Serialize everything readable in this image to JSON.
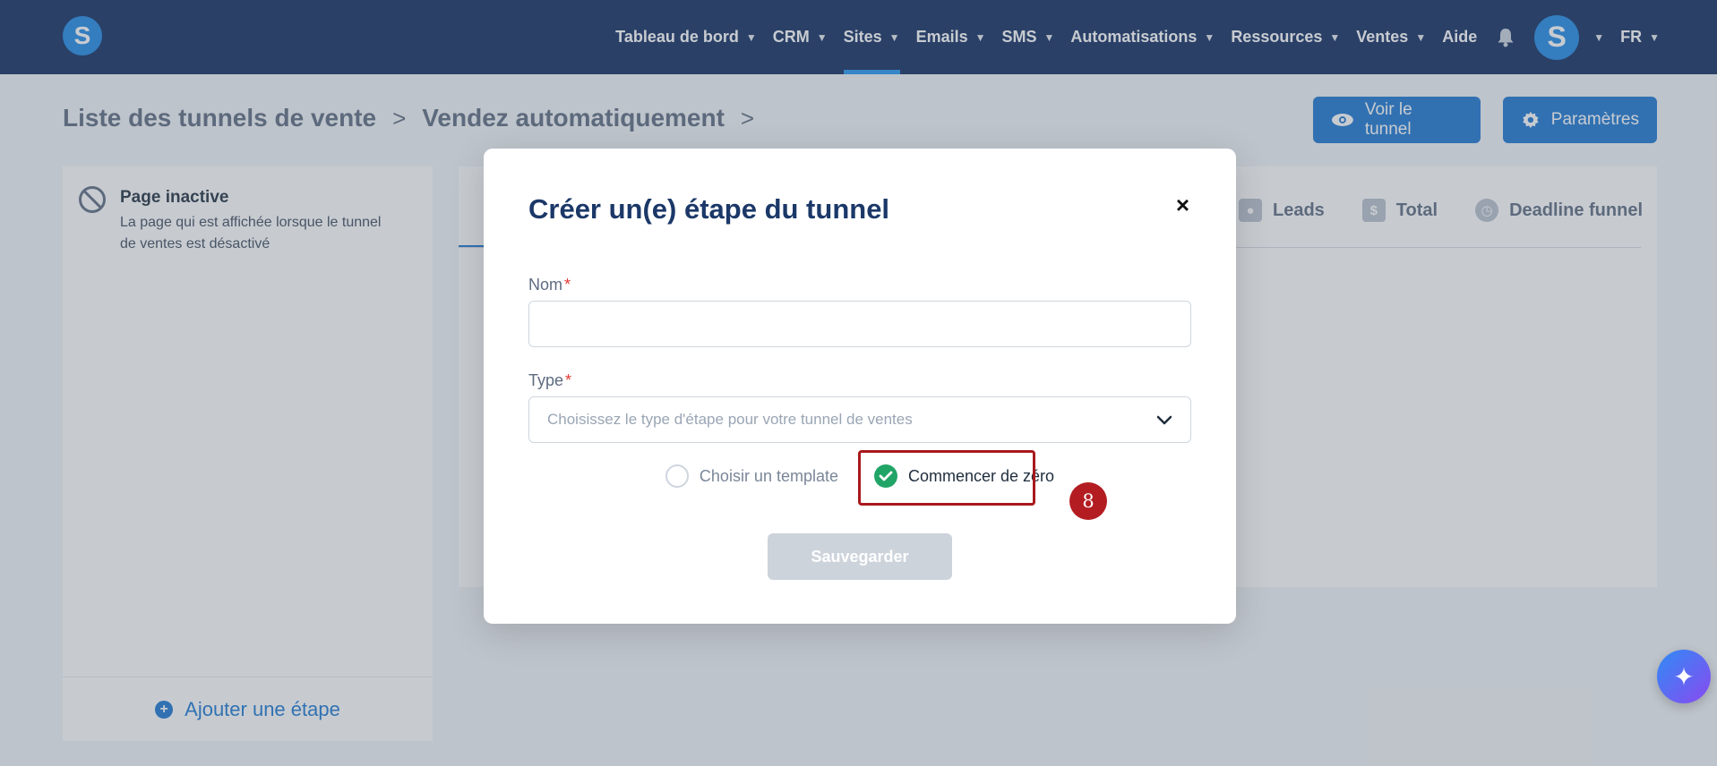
{
  "brand": {
    "logo_letter": "S",
    "accent_color": "#1976d2",
    "nav_bg": "#0f2a5f"
  },
  "nav": {
    "items": [
      {
        "label": "Tableau de bord",
        "has_chevron": true
      },
      {
        "label": "CRM",
        "has_chevron": true
      },
      {
        "label": "Sites",
        "has_chevron": true,
        "active": true
      },
      {
        "label": "Emails",
        "has_chevron": true
      },
      {
        "label": "SMS",
        "has_chevron": true
      },
      {
        "label": "Automatisations",
        "has_chevron": true
      },
      {
        "label": "Ressources",
        "has_chevron": true
      },
      {
        "label": "Ventes",
        "has_chevron": true
      },
      {
        "label": "Aide",
        "has_chevron": false
      }
    ],
    "bell_icon": "bell-icon",
    "avatar_letter": "S",
    "language": "FR"
  },
  "breadcrumb": {
    "items": [
      "Liste des tunnels de vente",
      "Vendez automatiquement"
    ],
    "separator": ">"
  },
  "header_buttons": {
    "view_funnel": "Voir le tunnel",
    "settings": "Paramètres"
  },
  "left_panel": {
    "item_title": "Page inactive",
    "item_description": "La page qui est affichée lorsque le tunnel de ventes est désactivé",
    "add_step": "Ajouter une étape"
  },
  "tabs": [
    {
      "label": "Leads",
      "icon": "user-icon"
    },
    {
      "label": "Total",
      "icon": "dollar-icon"
    },
    {
      "label": "Deadline funnel",
      "icon": "clock-icon"
    }
  ],
  "modal": {
    "title": "Créer un(e) étape du tunnel",
    "close": "×",
    "name_label": "Nom",
    "name_value": "",
    "type_label": "Type",
    "required_mark": "*",
    "type_placeholder": "Choisissez le type d'étape pour votre tunnel de ventes",
    "option_template": "Choisir un template",
    "option_scratch": "Commencer de zéro",
    "selected_option": "Commencer de zéro",
    "save": "Sauvegarder",
    "step_badge": "8"
  }
}
